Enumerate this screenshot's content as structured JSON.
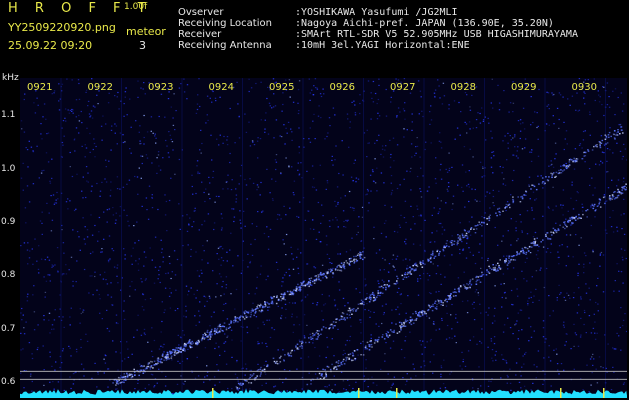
{
  "header": {
    "app_name": "H R O F F T",
    "version": "1.00f",
    "filename": "YY2509220920.png",
    "detect_label": "meteor",
    "timestamp": "25.09.22 09:20",
    "detect_count": "3"
  },
  "info": {
    "rows": [
      {
        "label": "Ovserver",
        "value": ":YOSHIKAWA Yasufumi /JG2MLI"
      },
      {
        "label": "Receiving Location",
        "value": ":Nagoya Aichi-pref. JAPAN (136.90E, 35.20N)"
      },
      {
        "label": "Receiver",
        "value": ":SMArt RTL-SDR V5 52.905MHz USB HIGASHIMURAYAMA"
      },
      {
        "label": "Receiving Antenna",
        "value": ":10mH 3el.YAGI Horizontal:ENE"
      }
    ]
  },
  "spectrogram": {
    "y_unit": "kHz",
    "time_labels": [
      "0921",
      "0922",
      "0923",
      "0924",
      "0925",
      "0926",
      "0927",
      "0928",
      "0929",
      "0930"
    ],
    "freq_ticks": [
      "1.1",
      "1.0",
      "0.9",
      "0.8",
      "0.7",
      "0.6"
    ],
    "freq_values": [
      1.1,
      1.0,
      0.9,
      0.8,
      0.7,
      0.6
    ],
    "freq_range_khz": [
      0.57,
      1.17
    ],
    "background_color": "#03031a",
    "noise_color": "#2a3bff",
    "floor_color": "#22e0ff",
    "accent_color": "#e9e94a",
    "traces": [
      {
        "start_minute": 0.0,
        "start_khz": 0.6,
        "end_minute": 4.1,
        "end_khz": 0.84
      },
      {
        "start_minute": 3.2,
        "start_khz": 0.6,
        "end_minute": 9.2,
        "end_khz": 1.02
      },
      {
        "start_minute": 2.0,
        "start_khz": 0.59,
        "end_minute": 9.6,
        "end_khz": 1.17
      }
    ]
  }
}
